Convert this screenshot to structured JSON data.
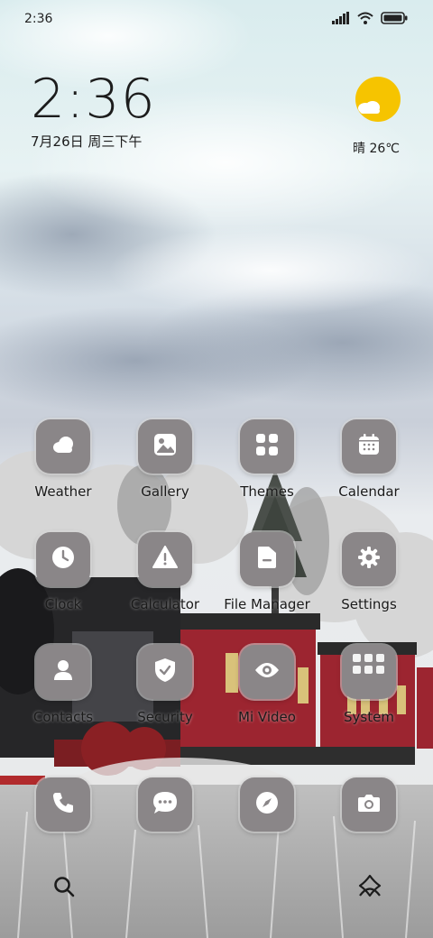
{
  "status_bar": {
    "time": "2:36"
  },
  "clock_widget": {
    "time": "2:36",
    "date": "7月26日 周三下午"
  },
  "weather_widget": {
    "text": "晴 26℃"
  },
  "apps": [
    {
      "label": "Weather",
      "icon": "cloud-icon"
    },
    {
      "label": "Gallery",
      "icon": "image-icon"
    },
    {
      "label": "Themes",
      "icon": "grid-icon"
    },
    {
      "label": "Calendar",
      "icon": "calendar-icon"
    },
    {
      "label": "Clock",
      "icon": "clock-icon"
    },
    {
      "label": "Calculator",
      "icon": "warning-icon"
    },
    {
      "label": "File Manager",
      "icon": "folder-icon"
    },
    {
      "label": "Settings",
      "icon": "gear-icon"
    },
    {
      "label": "Contacts",
      "icon": "person-icon"
    },
    {
      "label": "Security",
      "icon": "shield-icon"
    },
    {
      "label": "Mi Video",
      "icon": "eye-icon"
    },
    {
      "label": "System",
      "icon": "folder-grid-icon"
    }
  ],
  "dock": [
    {
      "icon": "phone-icon"
    },
    {
      "icon": "message-icon"
    },
    {
      "icon": "compass-icon"
    },
    {
      "icon": "camera-icon"
    }
  ],
  "colors": {
    "tile": "#8a8688",
    "sun": "#f6c400"
  }
}
